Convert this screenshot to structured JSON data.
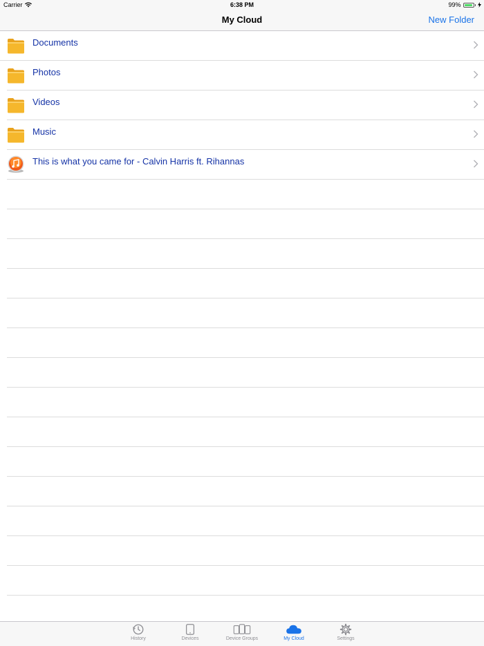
{
  "status": {
    "carrier": "Carrier",
    "time": "6:38 PM",
    "battery": "99%",
    "battery_level": 0.99
  },
  "nav": {
    "title": "My Cloud",
    "action": "New Folder"
  },
  "items": [
    {
      "label": "Documents",
      "icon": "folder-icon"
    },
    {
      "label": "Photos",
      "icon": "folder-icon"
    },
    {
      "label": "Videos",
      "icon": "folder-icon"
    },
    {
      "label": "Music",
      "icon": "folder-icon"
    },
    {
      "label": "This is what you came for - Calvin Harris ft. Rihannas",
      "icon": "music-file-icon"
    }
  ],
  "tabs": [
    {
      "label": "History",
      "icon": "history-icon",
      "active": false
    },
    {
      "label": "Devices",
      "icon": "tablet-icon",
      "active": false
    },
    {
      "label": "Device Groups",
      "icon": "device-groups-icon",
      "active": false
    },
    {
      "label": "My Cloud",
      "icon": "cloud-icon",
      "active": true
    },
    {
      "label": "Settings",
      "icon": "gear-icon",
      "active": false
    }
  ],
  "colors": {
    "accent": "#1a73e8",
    "item_text": "#1533a6",
    "folder": "#f5b72c",
    "battery": "#4cd964"
  }
}
